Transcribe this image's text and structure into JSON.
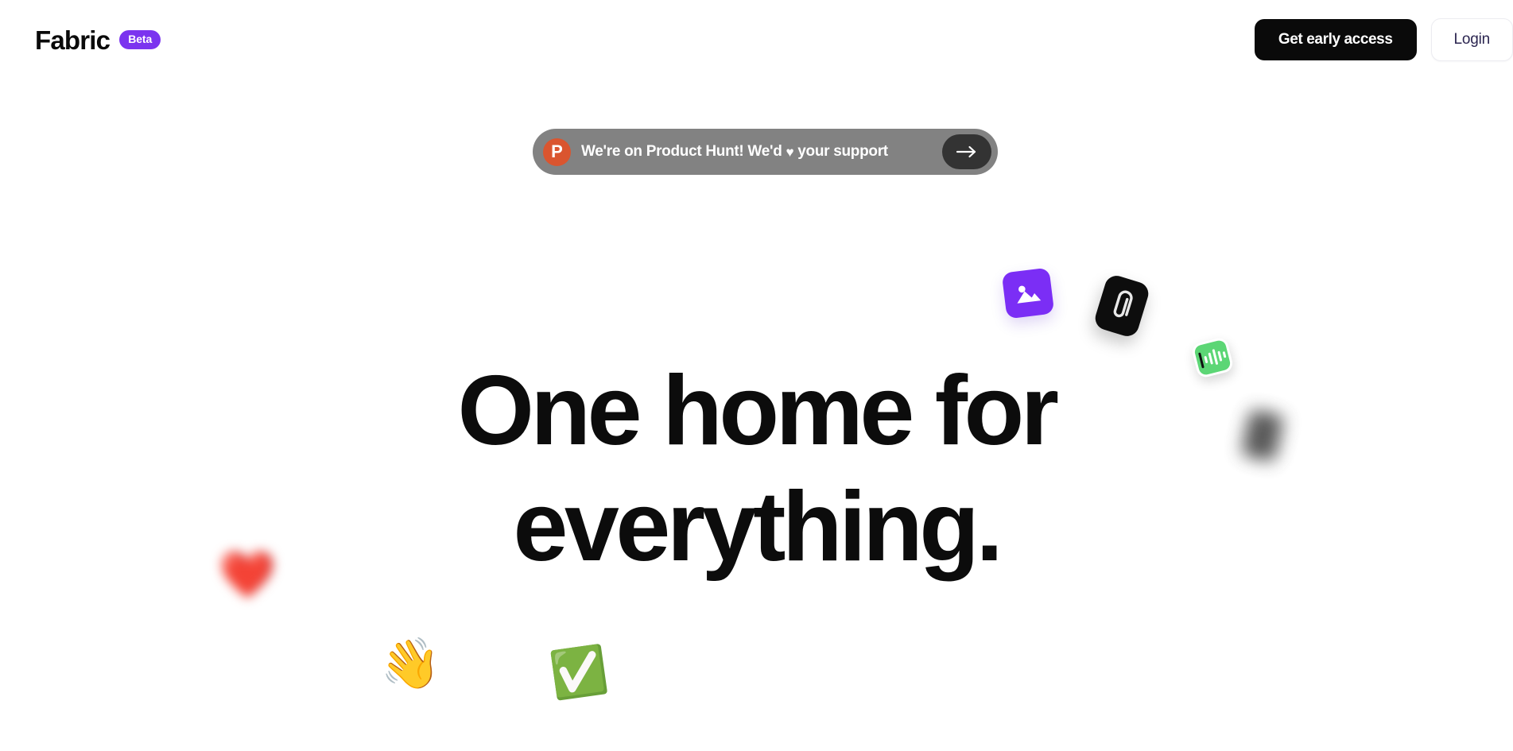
{
  "header": {
    "brand_name": "Fabric",
    "badge_label": "Beta",
    "badge_color": "#7B34EF",
    "actions": {
      "primary_label": "Get early access",
      "primary_bg": "#0a0a0a",
      "secondary_label": "Login",
      "secondary_text_color": "#2B2550"
    }
  },
  "banner": {
    "logo_letter": "P",
    "logo_color": "#DA552F",
    "background": "#828282",
    "text_before": "We're on Product Hunt! We'd ",
    "heart": "♥",
    "text_after": " your support",
    "arrow_icon": "arrow-right-icon",
    "arrow_bg": "#333333"
  },
  "hero": {
    "line1": "One home for",
    "line2": "everything.",
    "text_color": "#0c0c0c"
  },
  "decorations": [
    {
      "name": "image-icon",
      "kind": "image",
      "color": "#7B2EF5",
      "blurred": false
    },
    {
      "name": "paperclip-icon",
      "kind": "attachment",
      "color": "#0d0d0d",
      "blurred": false
    },
    {
      "name": "audio-waveform-icon",
      "kind": "audio",
      "color": "#5CD675",
      "blurred": false
    },
    {
      "name": "blurred-dark-icon",
      "kind": "unknown",
      "color": "#3d3d3d",
      "blurred": true
    },
    {
      "name": "heart-emoji",
      "kind": "emoji",
      "glyph": "❤️",
      "blurred": true
    },
    {
      "name": "waving-hand-emoji",
      "kind": "emoji",
      "glyph": "👋",
      "blurred": false
    },
    {
      "name": "check-mark-button-emoji",
      "kind": "emoji",
      "glyph": "✅",
      "blurred": false
    }
  ]
}
